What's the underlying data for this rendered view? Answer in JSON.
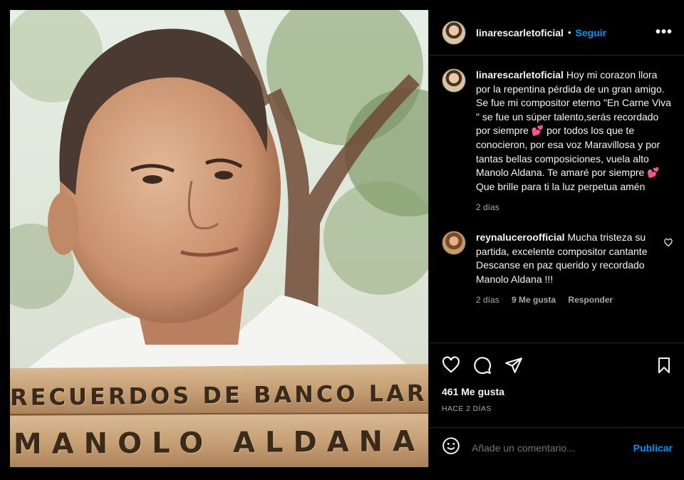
{
  "media": {
    "sign_top": "RECUERDOS DE BANCO LARGO",
    "sign_bottom": "MANOLO ALDANA"
  },
  "header": {
    "username": "linarescarletoficial",
    "separator": "•",
    "follow_label": "Seguir",
    "more_icon": "more-horizontal-icon"
  },
  "caption": {
    "username": "linarescarletoficial",
    "text": "Hoy mi corazon llora por la repentina pérdida de un gran amigo. Se fue mi compositor eterno \"En Carne Viva \" se fue un súper talento,serás recordado por siempre 💕 por todos los que te conocieron, por esa voz Maravillosa y por tantas bellas composiciones, vuela alto Manolo Aldana. Te amaré por siempre 💕 Que brille para ti la luz perpetua amén",
    "time": "2 días"
  },
  "comment": {
    "username": "reynaluceroofficial",
    "text": "Mucha tristeza su partida, excelente compositor cantante Descanse en paz querido y recordado Manolo Aldana !!!",
    "time": "2 días",
    "likes": "9 Me gusta",
    "reply_label": "Responder"
  },
  "actions": {
    "like_icon": "heart-icon",
    "comment_icon": "comment-icon",
    "share_icon": "share-icon",
    "save_icon": "bookmark-icon"
  },
  "likes_text": "461 Me gusta",
  "posted_ago": "HACE 2 DÍAS",
  "add_comment": {
    "placeholder": "Añade un comentario...",
    "post_label": "Publicar"
  },
  "colors": {
    "accent": "#0095f6",
    "background": "#000000",
    "secondary_text": "#a8a8a8",
    "divider": "#262626"
  }
}
